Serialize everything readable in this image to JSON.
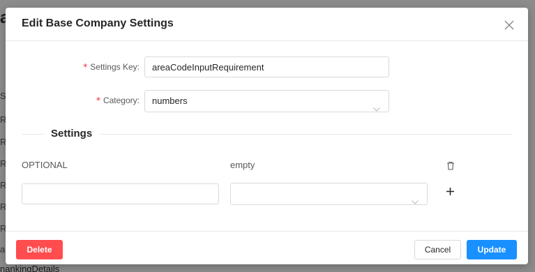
{
  "background": {
    "title_fragment": "a",
    "column_header_fragment": "S",
    "row_fragments": [
      "R",
      "R",
      "R",
      "R",
      "R",
      "R",
      "a"
    ],
    "bottom_fragment": "nankingDetails"
  },
  "modal": {
    "title": "Edit Base Company Settings",
    "close_icon": "close-icon",
    "fields": {
      "settings_key": {
        "label": "Settings Key",
        "required_mark": "*",
        "value": "areaCodeInputRequirement"
      },
      "category": {
        "label": "Category",
        "required_mark": "*",
        "value": "numbers"
      }
    },
    "settings_section": {
      "title": "Settings",
      "row": {
        "key": "OPTIONAL",
        "value": "empty",
        "delete_icon": "trash-icon"
      },
      "new_row": {
        "key_input_value": "",
        "value_select_value": "",
        "add_icon": "plus-icon"
      }
    },
    "footer": {
      "delete_label": "Delete",
      "cancel_label": "Cancel",
      "update_label": "Update"
    }
  },
  "colors": {
    "primary": "#1890ff",
    "danger": "#ff4d4f",
    "required": "#f5222d",
    "overlay": "#8c8c8c"
  }
}
